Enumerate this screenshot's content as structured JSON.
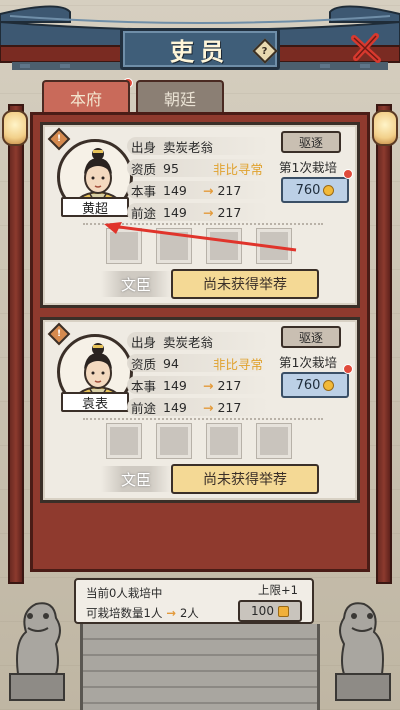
{
  "header": {
    "title": "吏员",
    "help_icon": "?"
  },
  "tabs": [
    {
      "label": "本府",
      "active": true
    },
    {
      "label": "朝廷",
      "active": false
    }
  ],
  "officials": [
    {
      "name": "黄超",
      "rank_badge": "!",
      "origin_label": "出身",
      "origin_value": "卖炭老翁",
      "aptitude_label": "资质",
      "aptitude_value": "95",
      "aptitude_tag": "非比寻常",
      "skill_label": "本事",
      "skill_value": "149",
      "skill_target": "217",
      "prospect_label": "前途",
      "prospect_value": "149",
      "prospect_target": "217",
      "dismiss_label": "驱逐",
      "cultivate_label": "第1次栽培",
      "cost": "760",
      "type_label": "文臣",
      "recommend_label": "尚未获得举荐"
    },
    {
      "name": "袁表",
      "rank_badge": "!",
      "origin_label": "出身",
      "origin_value": "卖炭老翁",
      "aptitude_label": "资质",
      "aptitude_value": "94",
      "aptitude_tag": "非比寻常",
      "skill_label": "本事",
      "skill_value": "149",
      "skill_target": "217",
      "prospect_label": "前途",
      "prospect_value": "149",
      "prospect_target": "217",
      "dismiss_label": "驱逐",
      "cultivate_label": "第1次栽培",
      "cost": "760",
      "type_label": "文臣",
      "recommend_label": "尚未获得举荐"
    }
  ],
  "footer": {
    "current_text": "当前0人栽培中",
    "capacity_text": "可栽培数量1人",
    "capacity_target": "2人",
    "limit_label": "上限+1",
    "limit_cost": "100"
  },
  "colors": {
    "accent": "#e0a22e",
    "frame": "#8f3a2e",
    "plaque": "#3f5e79",
    "tab_active": "#c96a5a"
  }
}
